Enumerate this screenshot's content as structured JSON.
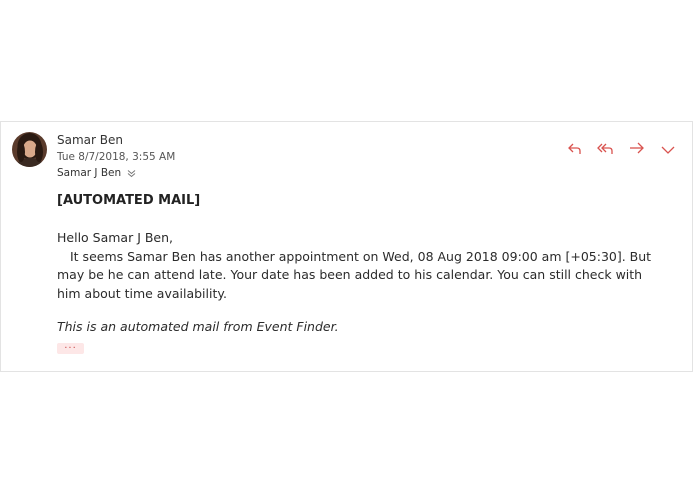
{
  "message": {
    "sender_name": "Samar Ben",
    "sent_time": "Tue 8/7/2018, 3:55 AM",
    "recipient": "Samar J Ben",
    "subject": "[AUTOMATED MAIL]",
    "greeting": "Hello Samar J Ben,",
    "body": "It seems Samar Ben has another appointment on Wed, 08 Aug 2018 09:00 am [+05:30]. But may be he can attend late. Your date has been added to his calendar. You can still check with him about time availability.",
    "footer_note": "This is an automated mail from Event Finder.",
    "more_label": "···"
  },
  "icons": {
    "avatar": "avatar",
    "expand_recipients": "double-chevron-down-icon",
    "reply": "reply-icon",
    "reply_all": "reply-all-icon",
    "forward": "forward-icon",
    "more_actions": "chevron-down-icon"
  },
  "colors": {
    "accent": "#d9534f",
    "border": "#e3e3e3",
    "more_bg": "#fde7e7"
  }
}
